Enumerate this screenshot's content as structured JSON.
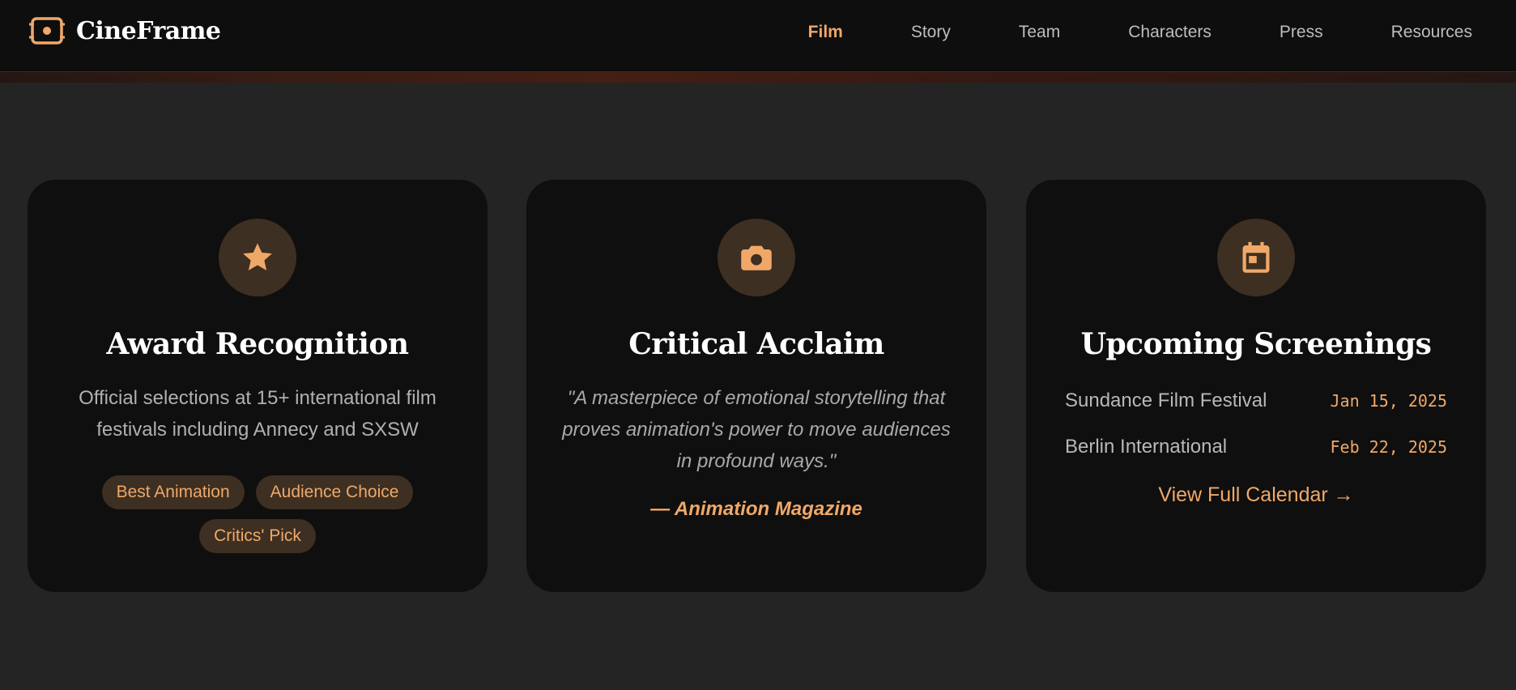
{
  "brand": {
    "name": "CineFrame",
    "icon": "film-frame-icon"
  },
  "nav": {
    "items": [
      {
        "label": "Film",
        "active": true
      },
      {
        "label": "Story",
        "active": false
      },
      {
        "label": "Team",
        "active": false
      },
      {
        "label": "Characters",
        "active": false
      },
      {
        "label": "Press",
        "active": false
      },
      {
        "label": "Resources",
        "active": false
      }
    ]
  },
  "cards": {
    "awards": {
      "icon": "star-icon",
      "title": "Award Recognition",
      "description": "Official selections at 15+ international film festivals including Annecy and SXSW",
      "badges": [
        "Best Animation",
        "Audience Choice",
        "Critics' Pick"
      ]
    },
    "acclaim": {
      "icon": "camera-icon",
      "title": "Critical Acclaim",
      "quote": "\"A masterpiece of emotional storytelling that proves animation's power to move audiences in profound ways.\"",
      "source": "— Animation Magazine"
    },
    "screenings": {
      "icon": "calendar-icon",
      "title": "Upcoming Screenings",
      "events": [
        {
          "name": "Sundance Film Festival",
          "date": "Jan 15, 2025"
        },
        {
          "name": "Berlin International",
          "date": "Feb 22, 2025"
        }
      ],
      "link_label": "View Full Calendar →"
    }
  },
  "colors": {
    "accent": "#f0a868",
    "icon_bg": "#3d2f22",
    "card_bg": "#0f0f0f",
    "page_bg": "#242424",
    "nav_bg": "#0e0e0e"
  }
}
